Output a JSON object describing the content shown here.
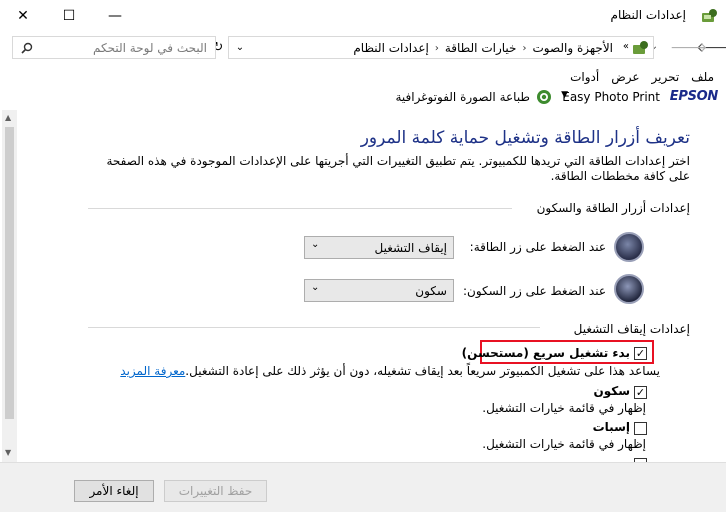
{
  "window": {
    "title": "إعدادات النظام",
    "minimize_glyph": "—",
    "maximize_glyph": "☐",
    "close_glyph": "✕"
  },
  "address": {
    "crumbs": [
      "الأجهزة والصوت",
      "خيارات الطاقة",
      "إعدادات النظام"
    ],
    "overflow": "«",
    "search_placeholder": "البحث في لوحة التحكم"
  },
  "menu": [
    "ملف",
    "تحرير",
    "عرض",
    "أدوات"
  ],
  "toolbar": {
    "epson_logo": "EPSON",
    "app_label": "Easy Photo Print",
    "print_label": "طباعة الصورة الفوتوغرافية"
  },
  "page": {
    "heading": "تعريف أزرار الطاقة وتشغيل حماية كلمة المرور",
    "intro": "اختر إعدادات الطاقة التي تريدها للكمبيوتر. يتم تطبيق التغييرات التي أجريتها على الإعدادات الموجودة في هذه الصفحة على كافة مخططات الطاقة.",
    "power_section_title": "إعدادات أزرار الطاقة والسكون",
    "power_button_label": "عند الضغط على زر الطاقة:",
    "power_button_value": "إيقاف التشغيل",
    "sleep_button_label": "عند الضغط على زر السكون:",
    "sleep_button_value": "سكون",
    "shutdown_section_title": "إعدادات إيقاف التشغيل",
    "fast_startup_label": "بدء تشغيل سريع (مستحسن)",
    "fast_startup_desc": "يساعد هذا على تشغيل الكمبيوتر سريعاً بعد إيقاف تشغيله، دون أن يؤثر ذلك على إعادة التشغيل.",
    "learn_more": "معرفة المزيد",
    "sleep_label": "سكون",
    "sleep_desc": "إظهار في قائمة خيارات التشغيل.",
    "hibernate_label": "إسبات",
    "hibernate_desc": "إظهار في قائمة خيارات التشغيل.",
    "fast_startup_checked": true,
    "sleep_checked": true,
    "hibernate_checked": false
  },
  "buttons": {
    "save": "حفظ التغييرات",
    "cancel": "إلغاء الأمر"
  },
  "colors": {
    "heading": "#1e3287",
    "highlight_border": "#e81123",
    "link": "#0066cc"
  }
}
